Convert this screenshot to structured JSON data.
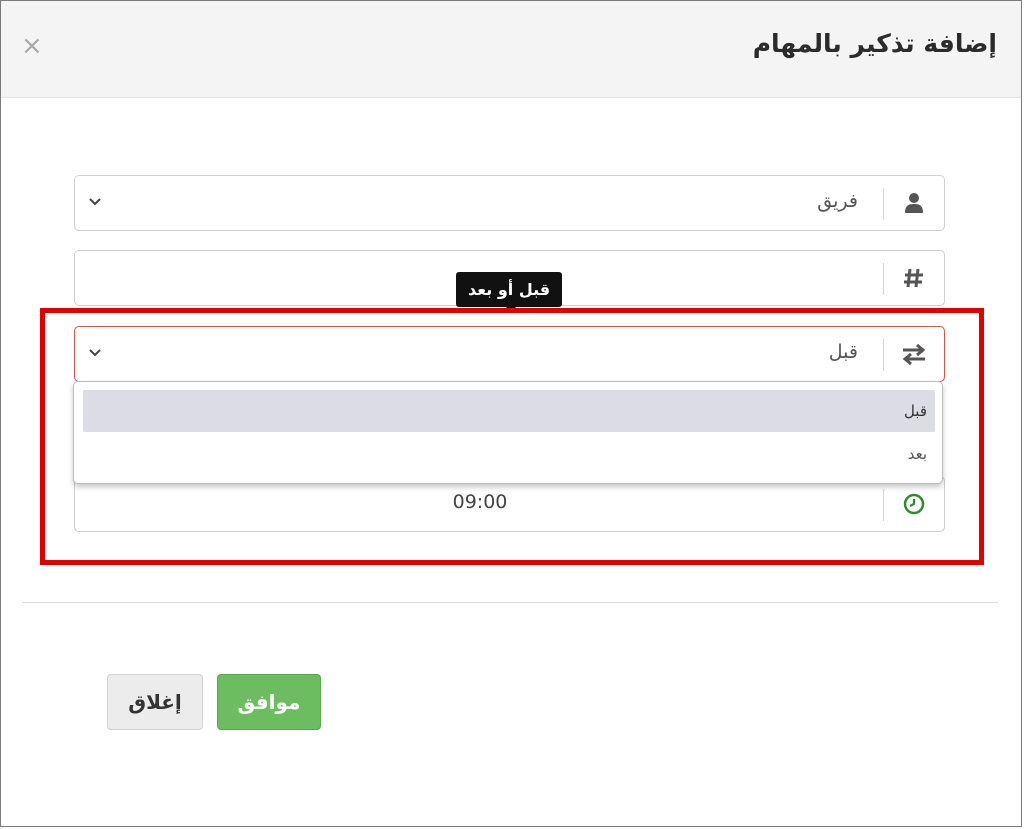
{
  "modal": {
    "title": "إضافة تذكير بالمهام",
    "close_glyph": "×"
  },
  "fields": {
    "team": {
      "value": "فريق",
      "icon": "user-icon"
    },
    "number": {
      "value": "",
      "icon": "hash-icon"
    },
    "before_after": {
      "value": "قبل",
      "icon": "swap-icon",
      "tooltip": "قبل أو بعد"
    },
    "time": {
      "value": "09:00",
      "icon": "clock-icon"
    }
  },
  "dropdown": {
    "options": [
      "قبل",
      "بعد"
    ],
    "selected_index": 0
  },
  "buttons": {
    "ok": "موافق",
    "close": "إغلاق"
  },
  "colors": {
    "ok_button": "#6cbd5f",
    "highlight_border": "#e30000",
    "clock_icon": "#2e8b2e"
  }
}
